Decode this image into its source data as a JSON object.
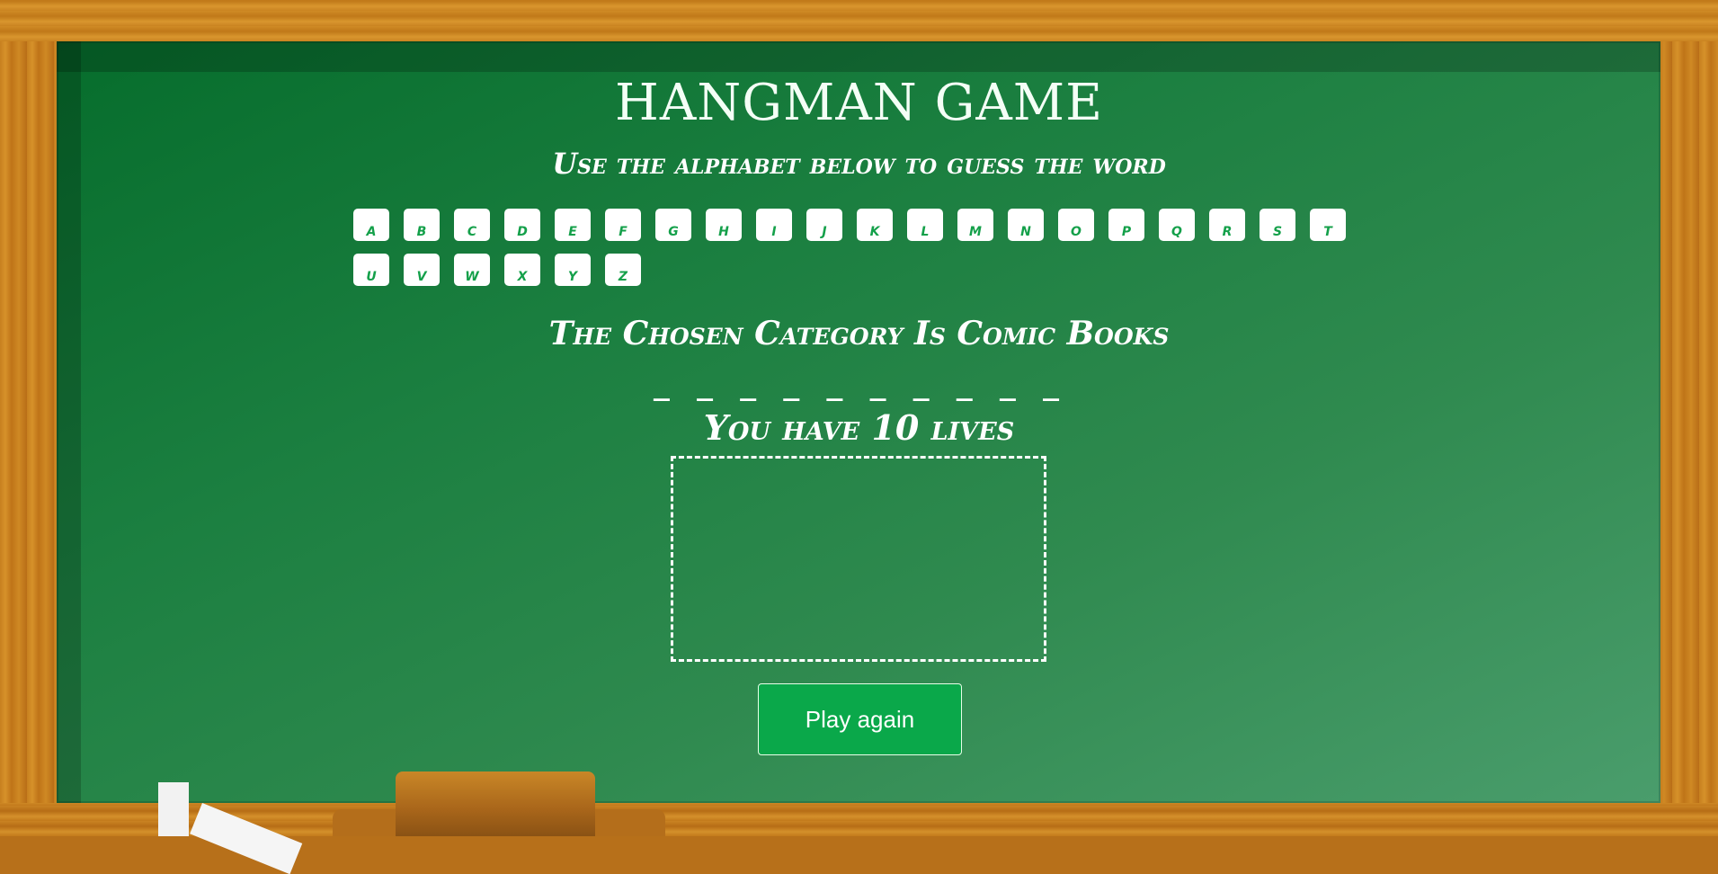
{
  "game": {
    "title": "HANGMAN GAME",
    "instructions": "Use the alphabet below to guess the word",
    "category_text": "The Chosen Category Is Comic Books",
    "word_blanks": "_ _ _ _ _ _ _ _ _ _",
    "lives_text": "You have 10 lives",
    "play_again_label": "Play again"
  },
  "alphabet": [
    "a",
    "b",
    "c",
    "d",
    "e",
    "f",
    "g",
    "h",
    "i",
    "j",
    "k",
    "l",
    "m",
    "n",
    "o",
    "p",
    "q",
    "r",
    "s",
    "t",
    "u",
    "v",
    "w",
    "x",
    "y",
    "z"
  ],
  "colors": {
    "board": "#1b7f40",
    "frame": "#c7801f",
    "button": "#0aa84a",
    "letter_text": "#14a04a"
  }
}
